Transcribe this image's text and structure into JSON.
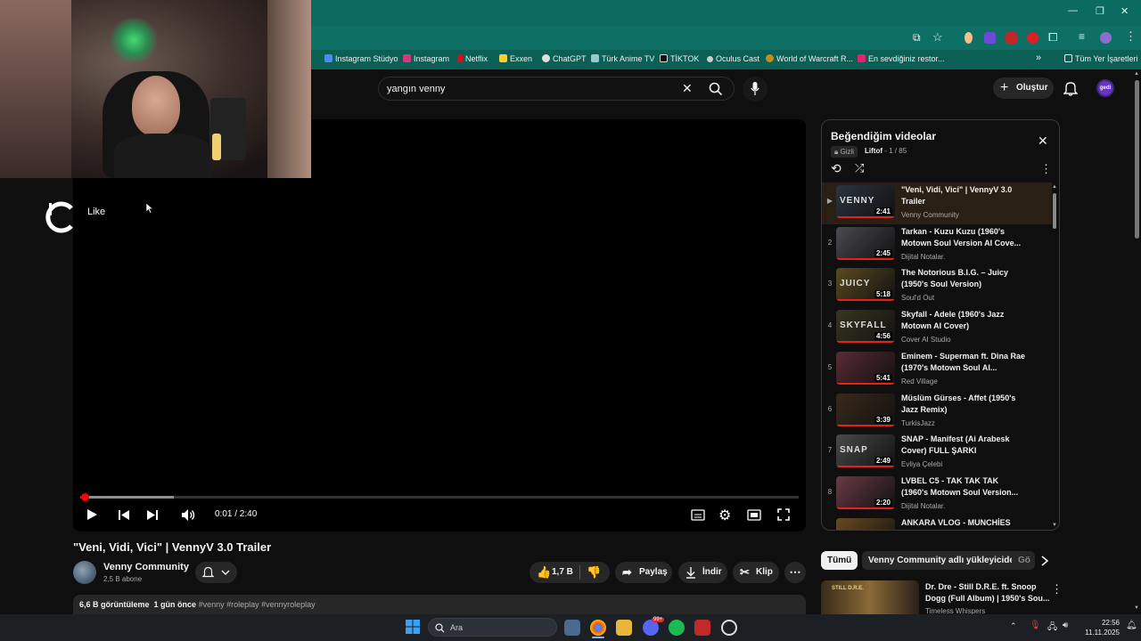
{
  "browser": {
    "bookmarks": [
      "Instagram Stüdyo",
      "Instagram",
      "Netflix",
      "Exxen",
      "ChatGPT",
      "Türk Anime TV",
      "TİKTOK",
      "Oculus Cast",
      "World of Warcraft R...",
      "En sevdiğiniz restor..."
    ],
    "all_bookmarks": "Tüm Yer İşaretleri"
  },
  "overlay": {
    "like_label": "Like"
  },
  "youtube": {
    "search_value": "yangın venny",
    "create_label": "Oluştur",
    "avatar_text": "gedi",
    "player": {
      "time": "0:01 / 2:40",
      "progress": 0.006,
      "buffered": 0.13
    },
    "video": {
      "title": "\"Veni, Vidi, Vici\" | VennyV 3.0 Trailer",
      "channel": "Venny Community",
      "subscribers": "2,5 B abone",
      "likes": "1,7 B",
      "share": "Paylaş",
      "download": "İndir",
      "clip": "Klip",
      "views": "6,6 B görüntüleme",
      "age": "1 gün önce",
      "tags": "#venny #roleplay #vennyroleplay"
    },
    "playlist": {
      "title": "Beğendiğim videolar",
      "privacy": "Gizli",
      "owner": "Liftof",
      "position": "- 1 / 85",
      "items": [
        {
          "index": "▶",
          "title": "\"Veni, Vidi, Vici\" | VennyV 3.0 Trailer",
          "channel": "Venny Community",
          "duration": "2:41",
          "thumb_text": "VENNY",
          "color": "#2b3440"
        },
        {
          "index": "2",
          "title": "Tarkan - Kuzu Kuzu (1960's Motown Soul Version AI Cove...",
          "channel": "Dijital Notalar.",
          "duration": "2:45",
          "thumb_text": "",
          "color": "#4a4a50"
        },
        {
          "index": "3",
          "title": "The Notorious B.I.G. – Juicy (1950's Soul Version)",
          "channel": "Soul'd Out",
          "duration": "5:18",
          "thumb_text": "JUICY",
          "color": "#5a4a20"
        },
        {
          "index": "4",
          "title": "Skyfall - Adele (1960's Jazz Motown AI Cover)",
          "channel": "Cover AI Studio",
          "duration": "4:56",
          "thumb_text": "SKYFALL",
          "color": "#3a3520"
        },
        {
          "index": "5",
          "title": "Eminem - Superman ft. Dina Rae (1970's Motown Soul AI...",
          "channel": "Red Village",
          "duration": "5:41",
          "thumb_text": "",
          "color": "#5a2a35"
        },
        {
          "index": "6",
          "title": "Müslüm Gürses - Affet (1950's Jazz Remix)",
          "channel": "TurkisJazz",
          "duration": "3:39",
          "thumb_text": "",
          "color": "#3a2a1a"
        },
        {
          "index": "7",
          "title": "SNAP - Manifest (Ai Arabesk Cover) FULL ŞARKI",
          "channel": "Evliya Çelebi",
          "duration": "2:49",
          "thumb_text": "SNAP",
          "color": "#4a4a4a"
        },
        {
          "index": "8",
          "title": "LVBEL C5 - TAK TAK TAK (1960's Motown Soul Version...",
          "channel": "Dijital Notalar.",
          "duration": "2:20",
          "thumb_text": "",
          "color": "#6a3a45"
        },
        {
          "index": "9",
          "title": "ANKARA VLOG - MUNCHİES",
          "channel": "",
          "duration": "",
          "thumb_text": "",
          "color": "#6a4a20"
        }
      ]
    },
    "chips": [
      "Tümü",
      "Venny Community adlı yükleyiciden",
      "Gö"
    ],
    "rec": {
      "title": "Dr. Dre - Still D.R.E. ft. Snoop Dogg (Full Album) | 1950's Sou...",
      "channel": "Timeless Whispers",
      "thumb_text": "STILL D.R.E."
    }
  },
  "taskbar": {
    "search_placeholder": "Ara",
    "time": "22:56",
    "date": "11.11.2025",
    "badge": "99+"
  }
}
